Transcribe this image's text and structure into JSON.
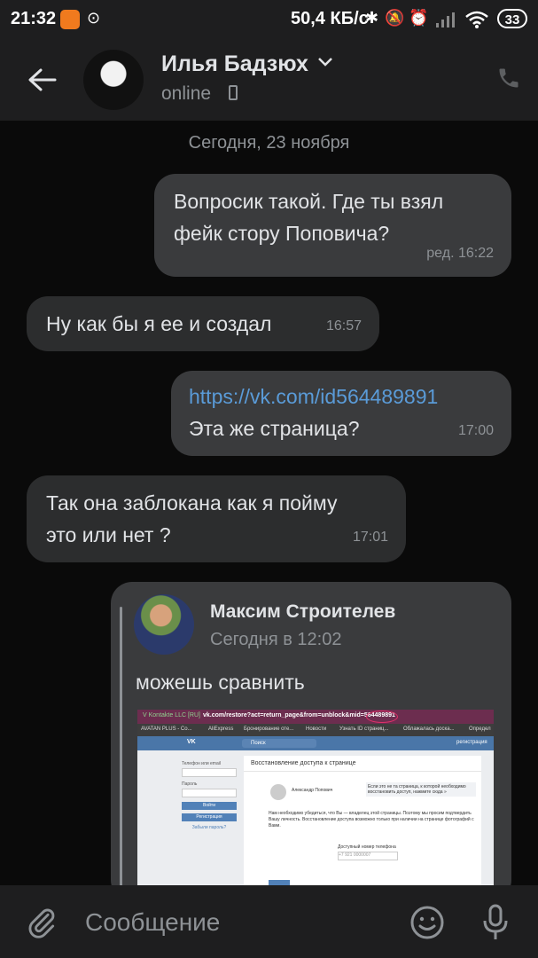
{
  "status_bar": {
    "time": "21:32",
    "network_rate": "50,4 КБ/с",
    "battery": "33"
  },
  "header": {
    "contact_name": "Илья Бадзюх",
    "presence": "online"
  },
  "chat": {
    "date_divider": "Сегодня, 23 ноября",
    "messages": [
      {
        "direction": "out",
        "lines": [
          "Вопросик такой. Где ты взял",
          "фейк стору Поповича?"
        ],
        "time": "ред. 16:22"
      },
      {
        "direction": "in",
        "lines": [
          "Ну как бы я ее и создал"
        ],
        "time": "16:57"
      },
      {
        "direction": "out",
        "link": "https://vk.com/id564489891",
        "lines": [
          "Эта же страница?"
        ],
        "time": "17:00"
      },
      {
        "direction": "in",
        "lines": [
          "Так она заблокана как я пойму",
          "это или нет ?"
        ],
        "time": "17:01"
      }
    ],
    "forwarded": {
      "author": "Максим Строителев",
      "time": "Сегодня в 12:02",
      "text": "можешь сравнить",
      "screenshot": {
        "browser_site": "V Kontakte LLC [RU]",
        "url": "vk.com/restore?act=return_page&from=unblock&mid=564489891",
        "bookmarks": [
          "AVATAN PLUS - Co...",
          "AliExpress",
          "Бронирование оте...",
          "Новости",
          "Узнать ID страниц...",
          "Облажалась доска...",
          "Определ"
        ],
        "search_placeholder": "Поиск",
        "register_link": "регистрация",
        "login_label": "Телефон или email",
        "password_label": "Пароль",
        "login_button": "Войти",
        "register_button": "Регистрация",
        "forgot_link": "Забыли пароль?",
        "page_title": "Восстановление доступа к странице",
        "profile_name": "Александр Попович",
        "notice": "Если это не та страница, к которой необходимо восстановить доступ, нажмите сюда »",
        "body_text": "Нам необходимо убедиться, что Вы — владелец этой страницы. Поэтому мы просим подтвердить Вашу личность. Восстановление доступа возможно только при наличии на странице фотографий с Вами.",
        "phone_label": "Доступный номер телефона",
        "phone_placeholder": "+7 921 0000007"
      }
    }
  },
  "composer": {
    "placeholder": "Сообщение"
  },
  "colors": {
    "link": "#5a9bd8",
    "bubble_out": "#3a3b3d",
    "bubble_in": "#2c2d2e",
    "background": "#0a0a0a",
    "bar": "#1e1e1f"
  }
}
